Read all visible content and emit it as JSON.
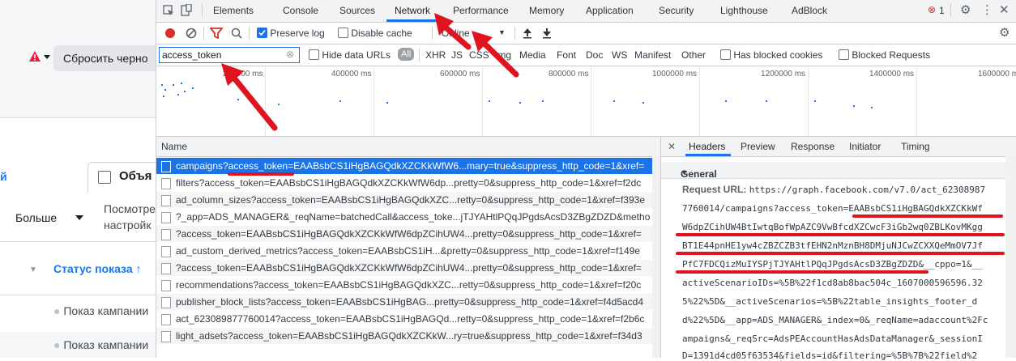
{
  "background_page": {
    "reset_button": "Сбросить черно",
    "tab_left": "й",
    "tab_objects": "Объя",
    "more_button": "Больше",
    "view_line1": "Посмотре",
    "view_line2": "настройк",
    "status_column": "Статус показа",
    "row_status_1": "Показ кампании",
    "row_status_2": "Показ кампании"
  },
  "devtools": {
    "tabs": [
      "Elements",
      "Console",
      "Sources",
      "Network",
      "Performance",
      "Memory",
      "Application",
      "Security",
      "Lighthouse",
      "AdBlock"
    ],
    "selected_tab": "Network",
    "error_count": "1",
    "toolbar": {
      "preserve_log": "Preserve log",
      "disable_cache": "Disable cache",
      "throttle": "Online"
    },
    "filter": {
      "value": "access_token",
      "hide_data_urls": "Hide data URLs",
      "all": "All",
      "types": [
        "XHR",
        "JS",
        "CSS",
        "Img",
        "Media",
        "Font",
        "Doc",
        "WS",
        "Manifest",
        "Other"
      ],
      "has_blocked_cookies": "Has blocked cookies",
      "blocked_requests": "Blocked Requests"
    },
    "overview_ticks": [
      "200000 ms",
      "400000 ms",
      "600000 ms",
      "800000 ms",
      "1000000 ms",
      "1200000 ms",
      "1400000 ms",
      "1600000 ms"
    ],
    "list_header": "Name",
    "requests": [
      "campaigns?access_token=EAABsbCS1iHgBAGQdkXZCKkWfW6...mary=true&suppress_http_code=1&xref=",
      "filters?access_token=EAABsbCS1iHgBAGQdkXZCKkWfW6dp...pretty=0&suppress_http_code=1&xref=f2dc",
      "ad_column_sizes?access_token=EAABsbCS1iHgBAGQdkXZC...retty=0&suppress_http_code=1&xref=f393e",
      "?_app=ADS_MANAGER&_reqName=batchedCall&access_toke...jTJYAHtlPQqJPgdsAcsD3ZBgZDZD&metho",
      "?access_token=EAABsbCS1iHgBAGQdkXZCKkWfW6dpZCihUW4...pretty=0&suppress_http_code=1&xref=",
      "ad_custom_derived_metrics?access_token=EAABsbCS1iH...&pretty=0&suppress_http_code=1&xref=f149e",
      "?access_token=EAABsbCS1iHgBAGQdkXZCKkWfW6dpZCihUW4...pretty=0&suppress_http_code=1&xref=",
      "recommendations?access_token=EAABsbCS1iHgBAGQdkXZC...retty=0&suppress_http_code=1&xref=f20c",
      "publisher_block_lists?access_token=EAABsbCS1iHgBAG...pretty=0&suppress_http_code=1&xref=f4d5acd4",
      "act_623089877760014?access_token=EAABsbCS1iHgBAGQd...retty=0&suppress_http_code=1&xref=f2b6c",
      "light_adsets?access_token=EAABsbCS1iHgBAGQdkXZCKkW...ry=true&suppress_http_code=1&xref=f34d3"
    ],
    "details": {
      "tabs": [
        "Headers",
        "Preview",
        "Response",
        "Initiator",
        "Timing"
      ],
      "selected_tab": "Headers",
      "section": "General",
      "request_url_label": "Request URL:",
      "url_lines": [
        "https://graph.facebook.com/v7.0/act_62308987",
        "7760014/campaigns?access_token=EAABsbCS1iHgBAGQdkXZCKkWf",
        "W6dpZCihUW4BtIwtqBofWpAZC9VwBfcdXZCwcF3iGb2wq0ZBLKovMKgg",
        "BT1E44pnHE1yw4cZBZCZB3tfEHN2nMznBH8DMjuNJCwZCXXQeMmOV7Jf",
        "PfC7FDCQizMuIYSPjTJYAHtlPQqJPgdsAcsD3ZBgZDZD&__cppo=1&__",
        "activeScenarioIDs=%5B%22f1cd8ab8bac504c_1607000596596.32",
        "5%22%5D&__activeScenarios=%5B%22table_insights_footer_d",
        "d%22%5D&__app=ADS_MANAGER&_index=0&_reqName=adaccount%2Fc",
        "ampaigns&_reqSrc=AdsPEAccountHasAdsDataManager&_sessionI",
        "D=1391d4cd05f63534&fields=id&filtering=%5B%7B%22field%2"
      ]
    },
    "colors": {
      "accent": "#1a73e8",
      "annotation": "#e0141e",
      "record": "#d93025"
    }
  }
}
